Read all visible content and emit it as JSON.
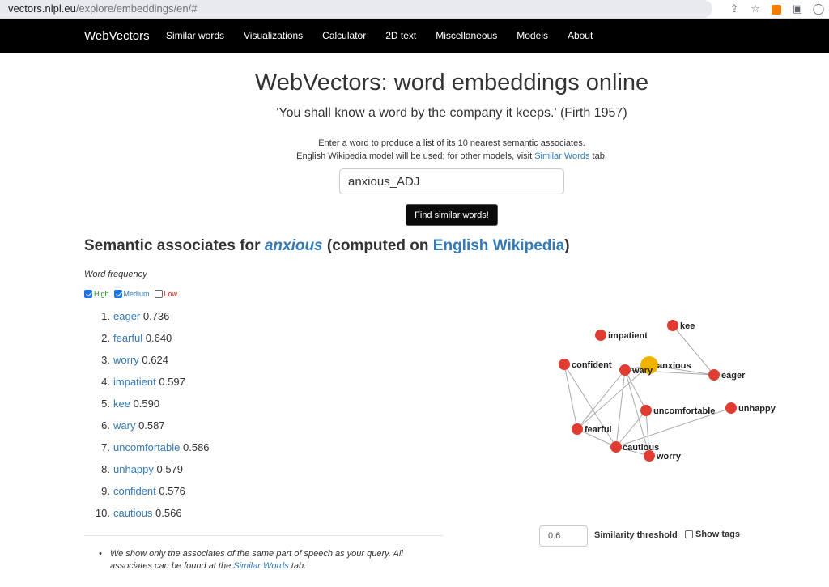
{
  "browser": {
    "url_host": "vectors.nlpl.eu",
    "url_path": "/explore/embeddings/en/#"
  },
  "navbar": {
    "brand": "WebVectors",
    "links": [
      "Similar words",
      "Visualizations",
      "Calculator",
      "2D text",
      "Miscellaneous",
      "Models",
      "About"
    ]
  },
  "header": {
    "title": "WebVectors: word embeddings online",
    "quote": "'You shall know a word by the company it keeps.' (Firth 1957)",
    "intro_line1": "Enter a word to produce a list of its 10 nearest semantic associates.",
    "intro_line2_pre": "English Wikipedia model will be used; for other models, visit ",
    "intro_link": "Similar Words",
    "intro_line2_post": " tab."
  },
  "search": {
    "value": "anxious_ADJ",
    "button": "Find similar words!"
  },
  "results_heading": {
    "pre": "Semantic associates for ",
    "query": "anxious",
    "mid": " (computed on ",
    "model": "English Wikipedia",
    "post": ")"
  },
  "frequency": {
    "label": "Word frequency",
    "options": [
      {
        "label": "High",
        "checked": true,
        "color": "#2e8b2e"
      },
      {
        "label": "Medium",
        "checked": true,
        "color": "#337ab7"
      },
      {
        "label": "Low",
        "checked": false,
        "color": "#e02020"
      }
    ]
  },
  "associates": [
    {
      "word": "eager",
      "score": "0.736"
    },
    {
      "word": "fearful",
      "score": "0.640"
    },
    {
      "word": "worry",
      "score": "0.624"
    },
    {
      "word": "impatient",
      "score": "0.597"
    },
    {
      "word": "kee",
      "score": "0.590"
    },
    {
      "word": "wary",
      "score": "0.587"
    },
    {
      "word": "uncomfortable",
      "score": "0.586"
    },
    {
      "word": "unhappy",
      "score": "0.579"
    },
    {
      "word": "confident",
      "score": "0.576"
    },
    {
      "word": "cautious",
      "score": "0.566"
    }
  ],
  "note": {
    "bullet": "•",
    "pre": "We show only the associates of the same part of speech as your query. All associates can be found at the ",
    "link": "Similar Words",
    "post": " tab."
  },
  "graph": {
    "center_color": "#f0b400",
    "node_color": "#e03c31",
    "edge_color": "#aaaaaa",
    "nodes": [
      "anxious",
      "impatient",
      "kee",
      "confident",
      "wary",
      "eager",
      "uncomfortable",
      "unhappy",
      "fearful",
      "cautious",
      "worry"
    ],
    "edges": [
      [
        "anxious",
        "wary"
      ],
      [
        "anxious",
        "eager"
      ],
      [
        "kee",
        "eager"
      ],
      [
        "wary",
        "eager"
      ],
      [
        "confident",
        "fearful"
      ],
      [
        "confident",
        "cautious"
      ],
      [
        "wary",
        "fearful"
      ],
      [
        "wary",
        "cautious"
      ],
      [
        "wary",
        "worry"
      ],
      [
        "wary",
        "uncomfortable"
      ],
      [
        "uncomfortable",
        "cautious"
      ],
      [
        "uncomfortable",
        "worry"
      ],
      [
        "fearful",
        "cautious"
      ],
      [
        "fearful",
        "anxious"
      ],
      [
        "unhappy",
        "cautious"
      ],
      [
        "cautious",
        "worry"
      ]
    ]
  },
  "controls": {
    "threshold_value": "0.6",
    "threshold_label": "Similarity threshold",
    "show_tags_label": "Show tags"
  }
}
